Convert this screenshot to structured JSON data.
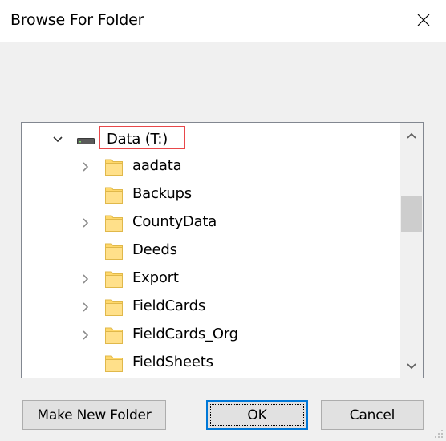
{
  "window": {
    "title": "Browse For Folder",
    "close_icon": "close-icon"
  },
  "tree": {
    "root": {
      "label": "Data (T:)",
      "icon": "drive-icon",
      "expanded": true
    },
    "items": [
      {
        "label": "aadata",
        "has_children": true
      },
      {
        "label": "Backups",
        "has_children": false
      },
      {
        "label": "CountyData",
        "has_children": true
      },
      {
        "label": "Deeds",
        "has_children": false
      },
      {
        "label": "Export",
        "has_children": true
      },
      {
        "label": "FieldCards",
        "has_children": true
      },
      {
        "label": "FieldCards_Org",
        "has_children": true
      },
      {
        "label": "FieldSheets",
        "has_children": false
      }
    ]
  },
  "buttons": {
    "make_new_folder": "Make New Folder",
    "ok": "OK",
    "cancel": "Cancel"
  },
  "colors": {
    "highlight_border": "#e8474a",
    "folder_fill": "#ffd86b",
    "default_button_border": "#0078d7"
  }
}
